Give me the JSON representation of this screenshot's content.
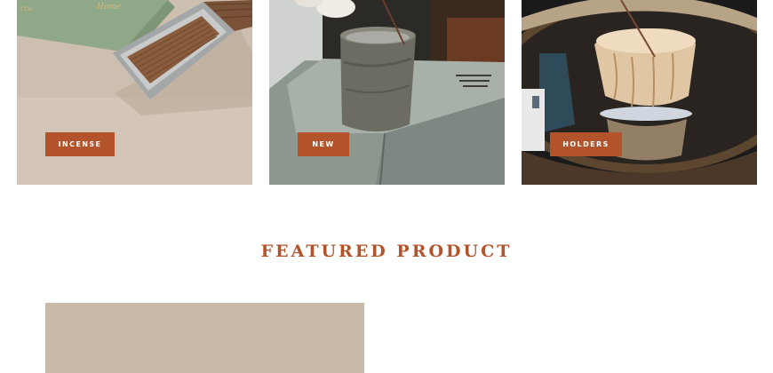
{
  "categories": [
    {
      "label": "INCENSE",
      "image": "green incense box with sticks"
    },
    {
      "label": "NEW",
      "image": "stone vessel with incense stick"
    },
    {
      "label": "HOLDERS",
      "image": "ceramic incense holder on tray"
    }
  ],
  "featured": {
    "title": "FEATURED PRODUCT"
  },
  "colors": {
    "accent": "#b3532b",
    "featured_bg": "#c9b9a7",
    "page_bg": "#ffffff"
  }
}
